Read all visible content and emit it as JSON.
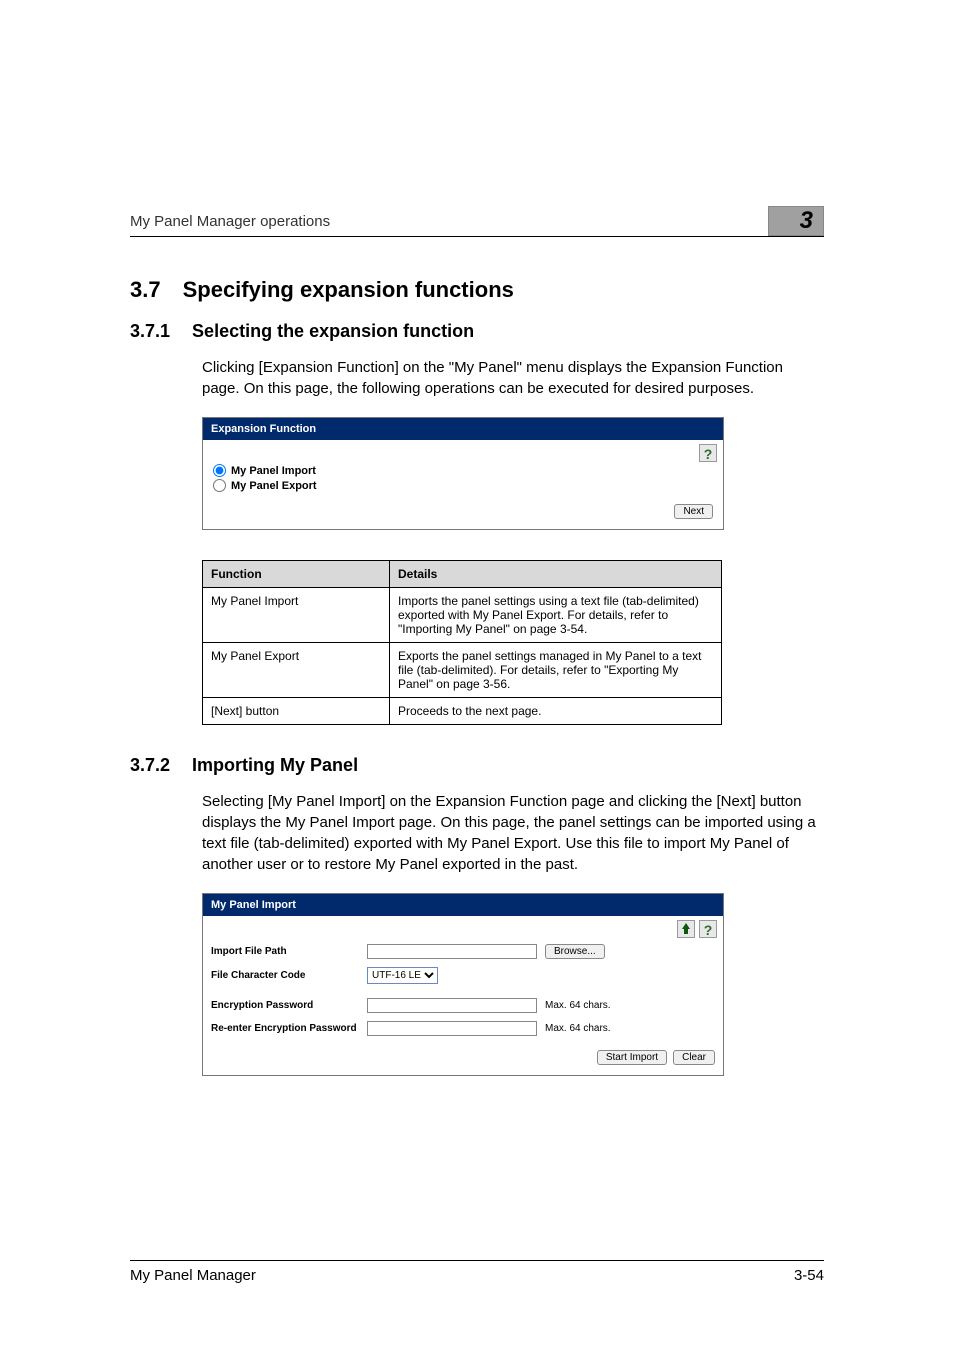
{
  "header": {
    "running_head": "My Panel Manager operations",
    "chapter_number": "3"
  },
  "section": {
    "num": "3.7",
    "title": "Specifying expansion functions"
  },
  "sub1": {
    "num": "3.7.1",
    "title": "Selecting the expansion function",
    "paragraph": "Clicking [Expansion Function] on the \"My Panel\" menu displays the Expansion Function page. On this page, the following operations can be executed for desired purposes."
  },
  "screenshot1": {
    "header": "Expansion Function",
    "help_glyph": "?",
    "option1": "My Panel Import",
    "option2": "My Panel Export",
    "next_btn": "Next"
  },
  "table": {
    "th_func": "Function",
    "th_details": "Details",
    "rows": [
      {
        "func": "My Panel Import",
        "detail": "Imports the panel settings using a text file (tab-delimited) exported with My Panel Export. For details, refer to \"Importing My Panel\" on page 3-54."
      },
      {
        "func": "My Panel Export",
        "detail": "Exports the panel settings managed in My Panel to a text file (tab-delimited). For details, refer to \"Exporting My Panel\" on page 3-56."
      },
      {
        "func": "[Next] button",
        "detail": "Proceeds to the next page."
      }
    ]
  },
  "sub2": {
    "num": "3.7.2",
    "title": "Importing My Panel",
    "paragraph": "Selecting [My Panel Import] on the Expansion Function page and clicking the [Next] button displays the My Panel Import page. On this page, the panel settings can be imported using a text file (tab-delimited) exported with My Panel Export. Use this file to import My Panel of another user or to restore My Panel exported in the past."
  },
  "screenshot2": {
    "header": "My Panel Import",
    "help_glyph": "?",
    "labels": {
      "path": "Import File Path",
      "code": "File Character Code",
      "pw": "Encryption Password",
      "pw2": "Re-enter Encryption Password"
    },
    "select_value": "UTF-16 LE",
    "browse_btn": "Browse...",
    "hint": "Max. 64 chars.",
    "start_btn": "Start Import",
    "clear_btn": "Clear"
  },
  "footer": {
    "left": "My Panel Manager",
    "right": "3-54"
  }
}
